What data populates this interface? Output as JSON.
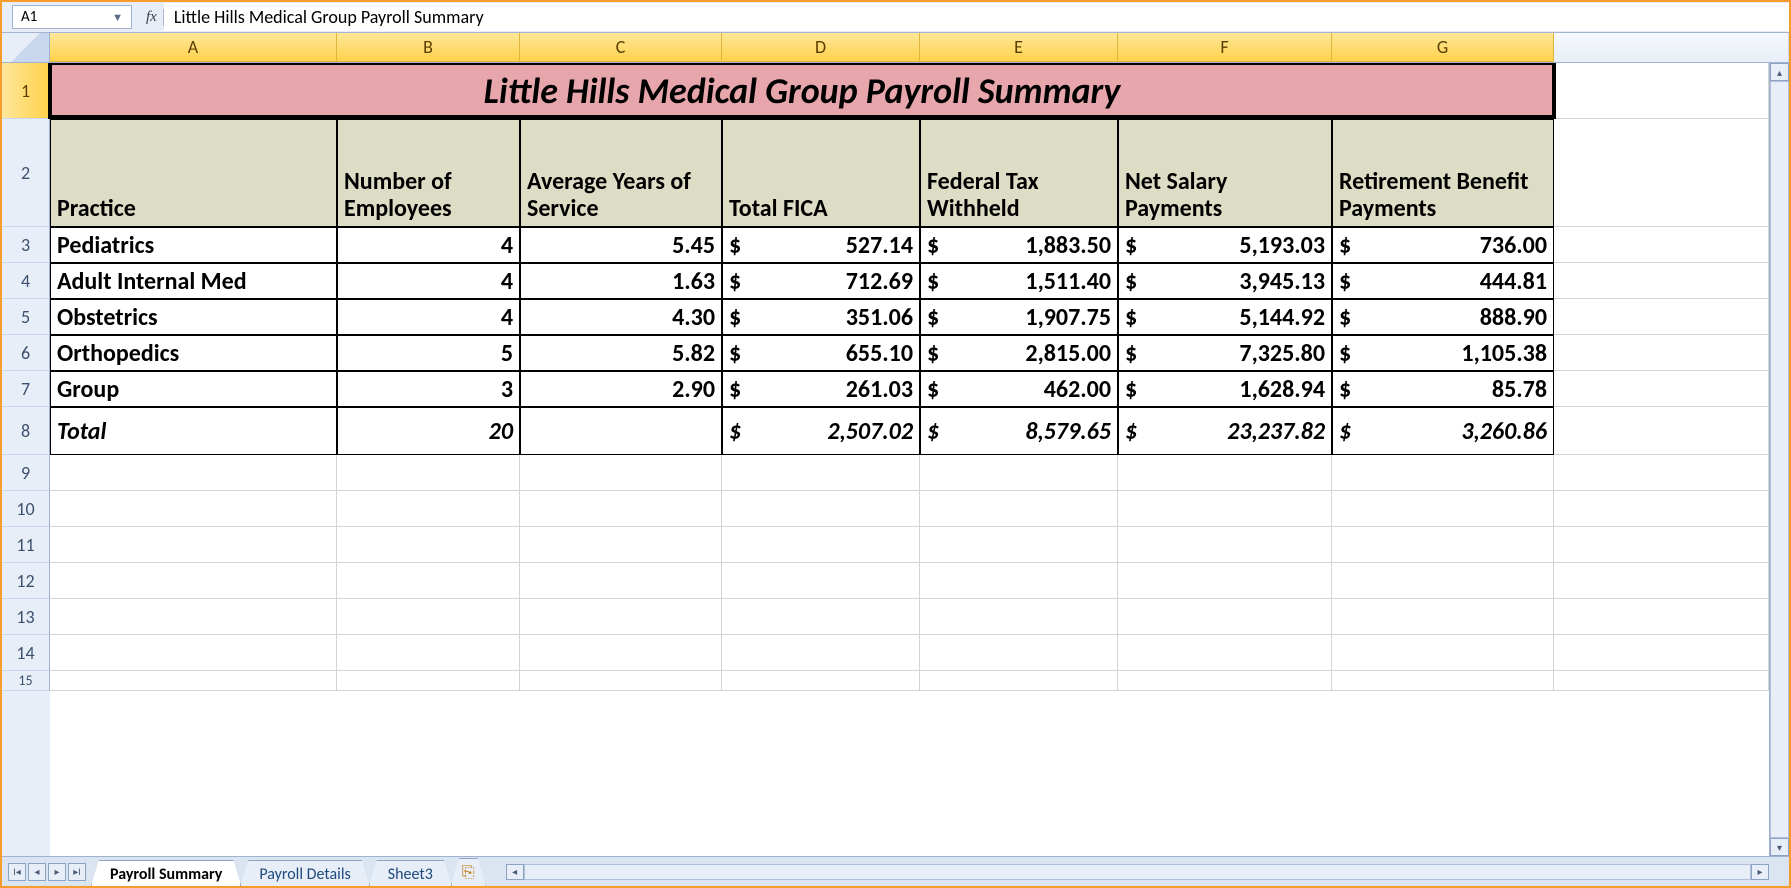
{
  "nameBox": "A1",
  "formula": "Little Hills Medical Group Payroll Summary",
  "fxLabel": "fx",
  "columns": [
    "A",
    "B",
    "C",
    "D",
    "E",
    "F",
    "G"
  ],
  "rowNums": [
    "1",
    "2",
    "3",
    "4",
    "5",
    "6",
    "7",
    "8",
    "9",
    "10",
    "11",
    "12",
    "13",
    "14",
    "15"
  ],
  "title": "Little Hills Medical Group Payroll Summary",
  "headers": {
    "practice": "Practice",
    "numEmp": "Number of Employees",
    "avgYears": "Average Years of Service",
    "fica": "Total FICA",
    "fedTax": "Federal Tax Withheld",
    "netPay": "Net Salary Payments",
    "retire": "Retirement Benefit Payments"
  },
  "currency": "$",
  "rows": [
    {
      "practice": "Pediatrics",
      "num": "4",
      "avg": "5.45",
      "fica": "527.14",
      "fed": "1,883.50",
      "net": "5,193.03",
      "ret": "736.00"
    },
    {
      "practice": "Adult Internal Med",
      "num": "4",
      "avg": "1.63",
      "fica": "712.69",
      "fed": "1,511.40",
      "net": "3,945.13",
      "ret": "444.81"
    },
    {
      "practice": "Obstetrics",
      "num": "4",
      "avg": "4.30",
      "fica": "351.06",
      "fed": "1,907.75",
      "net": "5,144.92",
      "ret": "888.90"
    },
    {
      "practice": "Orthopedics",
      "num": "5",
      "avg": "5.82",
      "fica": "655.10",
      "fed": "2,815.00",
      "net": "7,325.80",
      "ret": "1,105.38"
    },
    {
      "practice": "Group",
      "num": "3",
      "avg": "2.90",
      "fica": "261.03",
      "fed": "462.00",
      "net": "1,628.94",
      "ret": "85.78"
    }
  ],
  "total": {
    "label": "Total",
    "num": "20",
    "avg": "",
    "fica": "2,507.02",
    "fed": "8,579.65",
    "net": "23,237.82",
    "ret": "3,260.86"
  },
  "tabs": {
    "active": "Payroll Summary",
    "t2": "Payroll Details",
    "t3": "Sheet3",
    "new": "⎘"
  },
  "nav": {
    "first": "I◂",
    "prev": "◂",
    "next": "▸",
    "last": "▸I",
    "left": "◂",
    "right": "▸",
    "up": "▴",
    "down": "▾"
  }
}
